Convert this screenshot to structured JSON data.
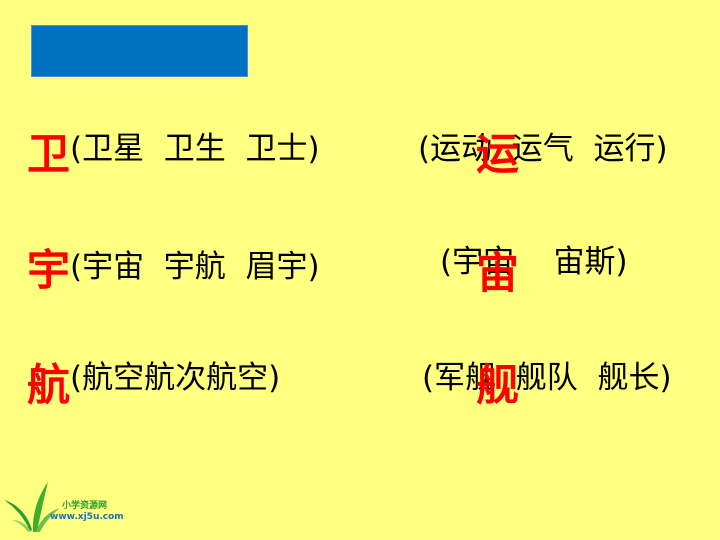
{
  "colors": {
    "background": "#ffff80",
    "title_box": "#0070c0",
    "highlight_char": "#ff0000",
    "text": "#000000",
    "logo_green": "#2e9c2e",
    "logo_url": "#1a6fbf"
  },
  "rows": [
    {
      "left_char": "卫",
      "left_words": "(卫星  卫生  卫士)",
      "right_words": "(运动  运气  运行)",
      "right_char": "运"
    },
    {
      "left_char": "宇",
      "left_words": "(宇宙  宇航  眉宇)",
      "right_words": "(宇宙    宙斯)",
      "right_char": "宙"
    },
    {
      "left_char": "航",
      "left_words": "(航空航次航空)",
      "right_words": "(军舰  舰队  舰长)",
      "right_char": "舰"
    }
  ],
  "logo": {
    "icon": "sprout-leaves-icon",
    "title": "小学资源网",
    "url": "www.xj5u.com"
  }
}
